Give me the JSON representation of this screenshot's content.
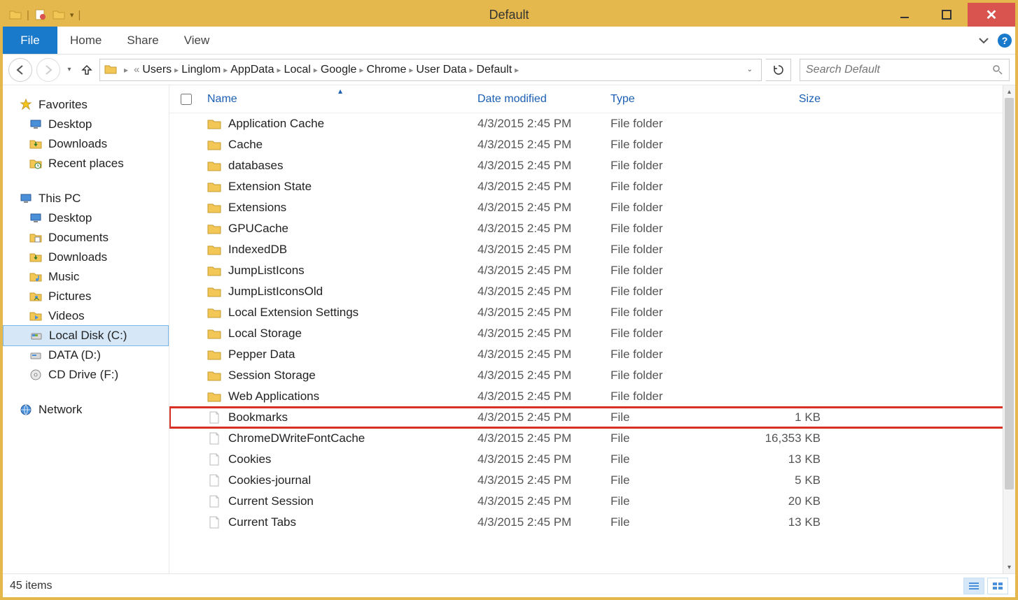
{
  "window": {
    "title": "Default"
  },
  "ribbon": {
    "file": "File",
    "tabs": [
      "Home",
      "Share",
      "View"
    ]
  },
  "address": {
    "crumbs": [
      "Users",
      "Linglom",
      "AppData",
      "Local",
      "Google",
      "Chrome",
      "User Data",
      "Default"
    ]
  },
  "search": {
    "placeholder": "Search Default"
  },
  "sidebar": {
    "favorites": {
      "label": "Favorites",
      "items": [
        "Desktop",
        "Downloads",
        "Recent places"
      ]
    },
    "thispc": {
      "label": "This PC",
      "items": [
        "Desktop",
        "Documents",
        "Downloads",
        "Music",
        "Pictures",
        "Videos",
        "Local Disk (C:)",
        "DATA (D:)",
        "CD Drive (F:)"
      ],
      "selected_index": 6
    },
    "network": {
      "label": "Network"
    }
  },
  "columns": {
    "name": "Name",
    "date": "Date modified",
    "type": "Type",
    "size": "Size"
  },
  "files": [
    {
      "name": "Application Cache",
      "date": "4/3/2015 2:45 PM",
      "type": "File folder",
      "size": "",
      "icon": "folder"
    },
    {
      "name": "Cache",
      "date": "4/3/2015 2:45 PM",
      "type": "File folder",
      "size": "",
      "icon": "folder"
    },
    {
      "name": "databases",
      "date": "4/3/2015 2:45 PM",
      "type": "File folder",
      "size": "",
      "icon": "folder"
    },
    {
      "name": "Extension State",
      "date": "4/3/2015 2:45 PM",
      "type": "File folder",
      "size": "",
      "icon": "folder"
    },
    {
      "name": "Extensions",
      "date": "4/3/2015 2:45 PM",
      "type": "File folder",
      "size": "",
      "icon": "folder"
    },
    {
      "name": "GPUCache",
      "date": "4/3/2015 2:45 PM",
      "type": "File folder",
      "size": "",
      "icon": "folder"
    },
    {
      "name": "IndexedDB",
      "date": "4/3/2015 2:45 PM",
      "type": "File folder",
      "size": "",
      "icon": "folder"
    },
    {
      "name": "JumpListIcons",
      "date": "4/3/2015 2:45 PM",
      "type": "File folder",
      "size": "",
      "icon": "folder"
    },
    {
      "name": "JumpListIconsOld",
      "date": "4/3/2015 2:45 PM",
      "type": "File folder",
      "size": "",
      "icon": "folder"
    },
    {
      "name": "Local Extension Settings",
      "date": "4/3/2015 2:45 PM",
      "type": "File folder",
      "size": "",
      "icon": "folder"
    },
    {
      "name": "Local Storage",
      "date": "4/3/2015 2:45 PM",
      "type": "File folder",
      "size": "",
      "icon": "folder"
    },
    {
      "name": "Pepper Data",
      "date": "4/3/2015 2:45 PM",
      "type": "File folder",
      "size": "",
      "icon": "folder"
    },
    {
      "name": "Session Storage",
      "date": "4/3/2015 2:45 PM",
      "type": "File folder",
      "size": "",
      "icon": "folder"
    },
    {
      "name": "Web Applications",
      "date": "4/3/2015 2:45 PM",
      "type": "File folder",
      "size": "",
      "icon": "folder"
    },
    {
      "name": "Bookmarks",
      "date": "4/3/2015 2:45 PM",
      "type": "File",
      "size": "1 KB",
      "icon": "file",
      "highlight": true
    },
    {
      "name": "ChromeDWriteFontCache",
      "date": "4/3/2015 2:45 PM",
      "type": "File",
      "size": "16,353 KB",
      "icon": "file"
    },
    {
      "name": "Cookies",
      "date": "4/3/2015 2:45 PM",
      "type": "File",
      "size": "13 KB",
      "icon": "file"
    },
    {
      "name": "Cookies-journal",
      "date": "4/3/2015 2:45 PM",
      "type": "File",
      "size": "5 KB",
      "icon": "file"
    },
    {
      "name": "Current Session",
      "date": "4/3/2015 2:45 PM",
      "type": "File",
      "size": "20 KB",
      "icon": "file"
    },
    {
      "name": "Current Tabs",
      "date": "4/3/2015 2:45 PM",
      "type": "File",
      "size": "13 KB",
      "icon": "file"
    }
  ],
  "status": {
    "count": "45 items"
  }
}
